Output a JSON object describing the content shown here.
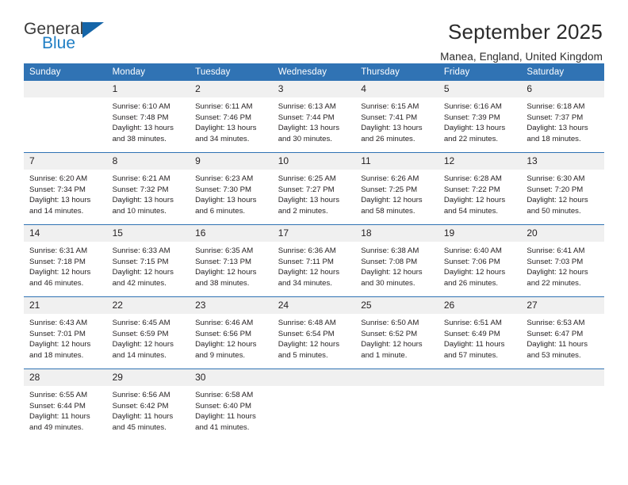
{
  "brand": {
    "name_part1": "General",
    "name_part2": "Blue",
    "flag_color": "#1565a8",
    "accent_color": "#1f7ec4"
  },
  "header": {
    "title": "September 2025",
    "subtitle": "Manea, England, United Kingdom",
    "header_bg": "#3073b4",
    "row_divider": "#2f72b3",
    "daynum_bg": "#f0f0f0"
  },
  "weekdays": [
    "Sunday",
    "Monday",
    "Tuesday",
    "Wednesday",
    "Thursday",
    "Friday",
    "Saturday"
  ],
  "weeks": [
    [
      {
        "day": "",
        "lines": []
      },
      {
        "day": "1",
        "lines": [
          "Sunrise: 6:10 AM",
          "Sunset: 7:48 PM",
          "Daylight: 13 hours",
          "and 38 minutes."
        ]
      },
      {
        "day": "2",
        "lines": [
          "Sunrise: 6:11 AM",
          "Sunset: 7:46 PM",
          "Daylight: 13 hours",
          "and 34 minutes."
        ]
      },
      {
        "day": "3",
        "lines": [
          "Sunrise: 6:13 AM",
          "Sunset: 7:44 PM",
          "Daylight: 13 hours",
          "and 30 minutes."
        ]
      },
      {
        "day": "4",
        "lines": [
          "Sunrise: 6:15 AM",
          "Sunset: 7:41 PM",
          "Daylight: 13 hours",
          "and 26 minutes."
        ]
      },
      {
        "day": "5",
        "lines": [
          "Sunrise: 6:16 AM",
          "Sunset: 7:39 PM",
          "Daylight: 13 hours",
          "and 22 minutes."
        ]
      },
      {
        "day": "6",
        "lines": [
          "Sunrise: 6:18 AM",
          "Sunset: 7:37 PM",
          "Daylight: 13 hours",
          "and 18 minutes."
        ]
      }
    ],
    [
      {
        "day": "7",
        "lines": [
          "Sunrise: 6:20 AM",
          "Sunset: 7:34 PM",
          "Daylight: 13 hours",
          "and 14 minutes."
        ]
      },
      {
        "day": "8",
        "lines": [
          "Sunrise: 6:21 AM",
          "Sunset: 7:32 PM",
          "Daylight: 13 hours",
          "and 10 minutes."
        ]
      },
      {
        "day": "9",
        "lines": [
          "Sunrise: 6:23 AM",
          "Sunset: 7:30 PM",
          "Daylight: 13 hours",
          "and 6 minutes."
        ]
      },
      {
        "day": "10",
        "lines": [
          "Sunrise: 6:25 AM",
          "Sunset: 7:27 PM",
          "Daylight: 13 hours",
          "and 2 minutes."
        ]
      },
      {
        "day": "11",
        "lines": [
          "Sunrise: 6:26 AM",
          "Sunset: 7:25 PM",
          "Daylight: 12 hours",
          "and 58 minutes."
        ]
      },
      {
        "day": "12",
        "lines": [
          "Sunrise: 6:28 AM",
          "Sunset: 7:22 PM",
          "Daylight: 12 hours",
          "and 54 minutes."
        ]
      },
      {
        "day": "13",
        "lines": [
          "Sunrise: 6:30 AM",
          "Sunset: 7:20 PM",
          "Daylight: 12 hours",
          "and 50 minutes."
        ]
      }
    ],
    [
      {
        "day": "14",
        "lines": [
          "Sunrise: 6:31 AM",
          "Sunset: 7:18 PM",
          "Daylight: 12 hours",
          "and 46 minutes."
        ]
      },
      {
        "day": "15",
        "lines": [
          "Sunrise: 6:33 AM",
          "Sunset: 7:15 PM",
          "Daylight: 12 hours",
          "and 42 minutes."
        ]
      },
      {
        "day": "16",
        "lines": [
          "Sunrise: 6:35 AM",
          "Sunset: 7:13 PM",
          "Daylight: 12 hours",
          "and 38 minutes."
        ]
      },
      {
        "day": "17",
        "lines": [
          "Sunrise: 6:36 AM",
          "Sunset: 7:11 PM",
          "Daylight: 12 hours",
          "and 34 minutes."
        ]
      },
      {
        "day": "18",
        "lines": [
          "Sunrise: 6:38 AM",
          "Sunset: 7:08 PM",
          "Daylight: 12 hours",
          "and 30 minutes."
        ]
      },
      {
        "day": "19",
        "lines": [
          "Sunrise: 6:40 AM",
          "Sunset: 7:06 PM",
          "Daylight: 12 hours",
          "and 26 minutes."
        ]
      },
      {
        "day": "20",
        "lines": [
          "Sunrise: 6:41 AM",
          "Sunset: 7:03 PM",
          "Daylight: 12 hours",
          "and 22 minutes."
        ]
      }
    ],
    [
      {
        "day": "21",
        "lines": [
          "Sunrise: 6:43 AM",
          "Sunset: 7:01 PM",
          "Daylight: 12 hours",
          "and 18 minutes."
        ]
      },
      {
        "day": "22",
        "lines": [
          "Sunrise: 6:45 AM",
          "Sunset: 6:59 PM",
          "Daylight: 12 hours",
          "and 14 minutes."
        ]
      },
      {
        "day": "23",
        "lines": [
          "Sunrise: 6:46 AM",
          "Sunset: 6:56 PM",
          "Daylight: 12 hours",
          "and 9 minutes."
        ]
      },
      {
        "day": "24",
        "lines": [
          "Sunrise: 6:48 AM",
          "Sunset: 6:54 PM",
          "Daylight: 12 hours",
          "and 5 minutes."
        ]
      },
      {
        "day": "25",
        "lines": [
          "Sunrise: 6:50 AM",
          "Sunset: 6:52 PM",
          "Daylight: 12 hours",
          "and 1 minute."
        ]
      },
      {
        "day": "26",
        "lines": [
          "Sunrise: 6:51 AM",
          "Sunset: 6:49 PM",
          "Daylight: 11 hours",
          "and 57 minutes."
        ]
      },
      {
        "day": "27",
        "lines": [
          "Sunrise: 6:53 AM",
          "Sunset: 6:47 PM",
          "Daylight: 11 hours",
          "and 53 minutes."
        ]
      }
    ],
    [
      {
        "day": "28",
        "lines": [
          "Sunrise: 6:55 AM",
          "Sunset: 6:44 PM",
          "Daylight: 11 hours",
          "and 49 minutes."
        ]
      },
      {
        "day": "29",
        "lines": [
          "Sunrise: 6:56 AM",
          "Sunset: 6:42 PM",
          "Daylight: 11 hours",
          "and 45 minutes."
        ]
      },
      {
        "day": "30",
        "lines": [
          "Sunrise: 6:58 AM",
          "Sunset: 6:40 PM",
          "Daylight: 11 hours",
          "and 41 minutes."
        ]
      },
      {
        "day": "",
        "lines": []
      },
      {
        "day": "",
        "lines": []
      },
      {
        "day": "",
        "lines": []
      },
      {
        "day": "",
        "lines": []
      }
    ]
  ]
}
